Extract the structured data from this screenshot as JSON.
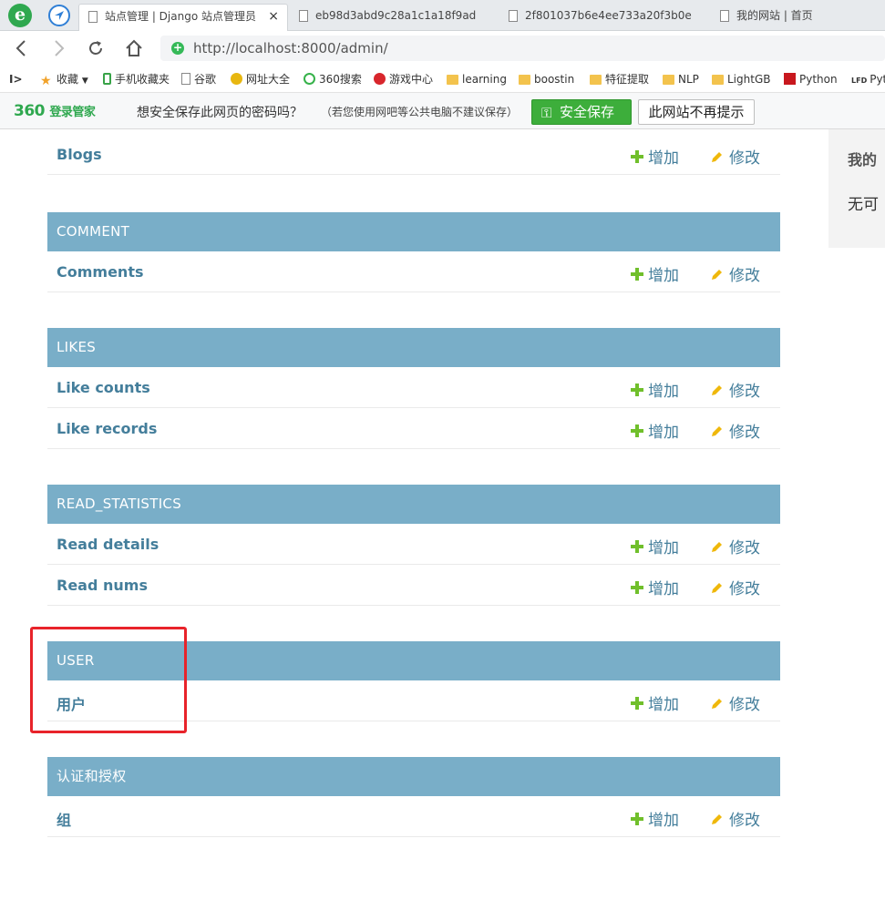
{
  "browser": {
    "tabs": [
      {
        "title": "站点管理 | Django 站点管理员",
        "active": true
      },
      {
        "title": "eb98d3abd9c28a1c1a18f9ad"
      },
      {
        "title": "2f801037b6e4ee733a20f3b0e"
      },
      {
        "title": "我的网站 | 首页"
      }
    ],
    "close_glyph": "×",
    "url_host": "http://localhost",
    "url_path": ":8000/admin/",
    "bookmarks": [
      {
        "label": "收藏",
        "icon": "star-icon"
      },
      {
        "label": "手机收藏夹",
        "icon": "phone-icon"
      },
      {
        "label": "谷歌",
        "icon": "page-icon"
      },
      {
        "label": "网址大全",
        "icon": "web-icon"
      },
      {
        "label": "360搜索",
        "icon": "search360-icon"
      },
      {
        "label": "游戏中心",
        "icon": "game-icon"
      },
      {
        "label": "learning",
        "icon": "folder-icon"
      },
      {
        "label": "boostin",
        "icon": "folder-icon"
      },
      {
        "label": "特征提取",
        "icon": "folder-icon"
      },
      {
        "label": "NLP",
        "icon": "folder-icon"
      },
      {
        "label": "LightGB",
        "icon": "folder-icon"
      },
      {
        "label": "Python",
        "icon": "python-icon"
      },
      {
        "label": "Pyt",
        "icon": "lfd-icon"
      }
    ],
    "password_bar": {
      "brand": "360",
      "brand_sub": "登录管家",
      "question": "想安全保存此网页的密码吗？",
      "hint": "（若您使用网吧等公共电脑不建议保存）",
      "save_label": "安全保存",
      "never_label": "此网站不再提示"
    }
  },
  "admin": {
    "add_label": "增加",
    "change_label": "修改",
    "modules": [
      {
        "caption": "",
        "models": [
          "Blogs"
        ]
      },
      {
        "caption": "COMMENT",
        "models": [
          "Comments"
        ]
      },
      {
        "caption": "LIKES",
        "models": [
          "Like counts",
          "Like records"
        ]
      },
      {
        "caption": "READ_STATISTICS",
        "models": [
          "Read details",
          "Read nums"
        ]
      },
      {
        "caption": "USER",
        "models": [
          "用户"
        ]
      },
      {
        "caption": "认证和授权",
        "models": [
          "组"
        ]
      }
    ],
    "sidebar": {
      "title": "我的",
      "text": "无可"
    }
  },
  "colors": {
    "module_caption_bg": "#79aec8",
    "link": "#447e9b",
    "add_green": "#70bf2b",
    "change_yellow": "#efb80b",
    "highlight_red": "#e8232a"
  }
}
